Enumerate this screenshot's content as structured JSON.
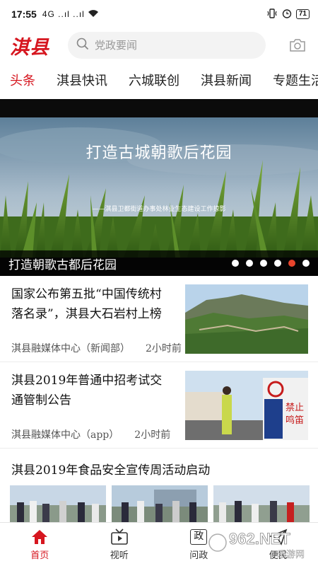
{
  "status": {
    "time": "17:55",
    "signal": "4G ..ıl ..ıl",
    "battery": "71"
  },
  "header": {
    "logo": "淇县",
    "search_placeholder": "党政要闻"
  },
  "tabs": [
    "头条",
    "淇县快讯",
    "六城联创",
    "淇县新闻",
    "专题生活"
  ],
  "banner": {
    "headline": "打造古城朝歌后花园",
    "subline": "——淇县卫都街道办事处林业生态建设工作掠影",
    "caption": "打造朝歌古都后花园",
    "dot_count": 6,
    "active_dot": 4
  },
  "news": [
    {
      "title_line1": "国家公布第五批“中国传统村",
      "title_line2": "落名录”，淇县大石岩村上榜",
      "source": "淇县融媒体中心（新闻部）",
      "time": "2小时前"
    },
    {
      "title_line1": " 淇县2019年普通中招考试交",
      "title_line2": "通管制公告",
      "source": "淇县融媒体中心（app）",
      "time": "2小时前"
    }
  ],
  "gallery_news": {
    "title": "淇县2019年食品安全宣传周活动启动"
  },
  "sign_text": {
    "line1": "禁止",
    "line2": "鸣笛"
  },
  "bottom_nav": [
    {
      "label": "首页",
      "icon": "home-icon"
    },
    {
      "label": "视听",
      "icon": "tv-icon"
    },
    {
      "label": "问政",
      "icon": "zheng-icon",
      "glyph": "政"
    },
    {
      "label": "便民",
      "icon": "paper-plane-icon"
    }
  ],
  "watermark": {
    "text": "962.NET",
    "sub": "乐游网"
  },
  "colors": {
    "accent": "#d6161f",
    "dot_active": "#e8442c"
  }
}
